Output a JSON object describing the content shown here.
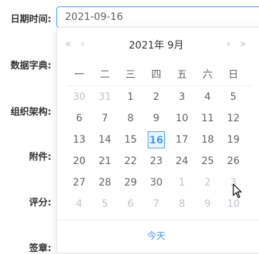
{
  "form": {
    "date_label": "日期时间:",
    "dict_label": "数据字典:",
    "org_label": "组织架构:",
    "attach_label": "附件:",
    "score_label": "评分:",
    "sign_label": "签章:"
  },
  "date_input": {
    "value": "2021-09-16"
  },
  "calendar": {
    "title": "2021年 9月",
    "prev_year": "«",
    "prev_month": "‹",
    "next_month": "›",
    "next_year": "»",
    "weekdays": [
      "一",
      "二",
      "三",
      "四",
      "五",
      "六",
      "日"
    ],
    "weeks": [
      [
        "30",
        "31",
        "1",
        "2",
        "3",
        "4",
        "5"
      ],
      [
        "6",
        "7",
        "8",
        "9",
        "10",
        "11",
        "12"
      ],
      [
        "13",
        "14",
        "15",
        "16",
        "17",
        "18",
        "19"
      ],
      [
        "20",
        "21",
        "22",
        "23",
        "24",
        "25",
        "26"
      ],
      [
        "27",
        "28",
        "29",
        "30",
        "1",
        "2",
        "3"
      ],
      [
        "4",
        "5",
        "6",
        "7",
        "8",
        "9",
        "10"
      ]
    ],
    "today_label": "今天"
  },
  "colors": {
    "accent": "#409eff",
    "muted": "#c0c4cc",
    "text": "#606266"
  }
}
